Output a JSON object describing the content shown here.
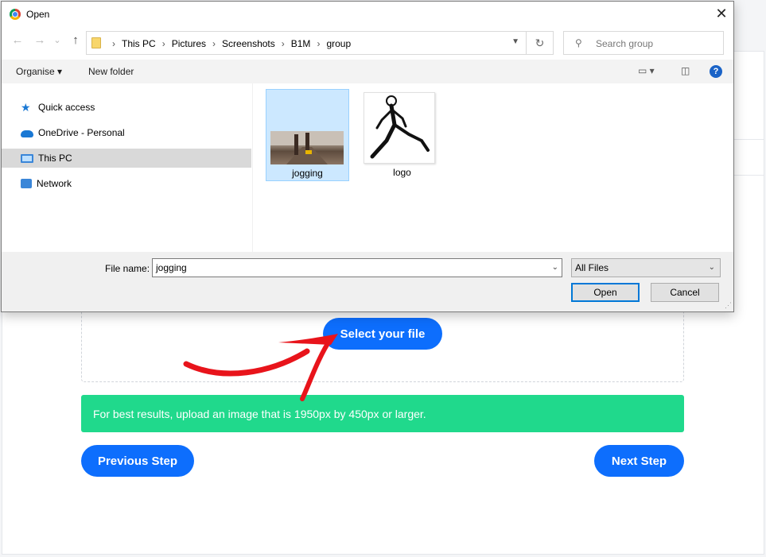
{
  "dialog": {
    "title": "Open",
    "close_glyph": "✕",
    "nav": {
      "back_glyph": "←",
      "forward_glyph": "→",
      "recent_glyph": "⌄",
      "up_glyph": "↑"
    },
    "breadcrumb": [
      "This PC",
      "Pictures",
      "Screenshots",
      "B1M",
      "group"
    ],
    "search_placeholder": "Search group",
    "toolbar": {
      "organise": "Organise ▾",
      "new_folder": "New folder",
      "help_glyph": "?"
    },
    "sidebar": [
      {
        "label": "Quick access",
        "icon": "star-icon"
      },
      {
        "label": "OneDrive - Personal",
        "icon": "cloud-icon"
      },
      {
        "label": "This PC",
        "icon": "computer-icon",
        "selected": true
      },
      {
        "label": "Network",
        "icon": "network-icon"
      }
    ],
    "files": [
      {
        "name": "jogging",
        "selected": true
      },
      {
        "name": "logo",
        "selected": false
      }
    ],
    "file_name_label": "File name:",
    "file_name_value": "jogging",
    "filter_value": "All Files",
    "open_label": "Open",
    "cancel_label": "Cancel"
  },
  "page": {
    "select_file_label": "Select your file",
    "info_text": "For best results, upload an image that is 1950px by 450px or larger.",
    "prev_label": "Previous Step",
    "next_label": "Next Step"
  },
  "colors": {
    "primary_button": "#0d6efd",
    "info_bar": "#20d98c",
    "arrow": "#e8141b",
    "selection": "#cce8ff"
  }
}
